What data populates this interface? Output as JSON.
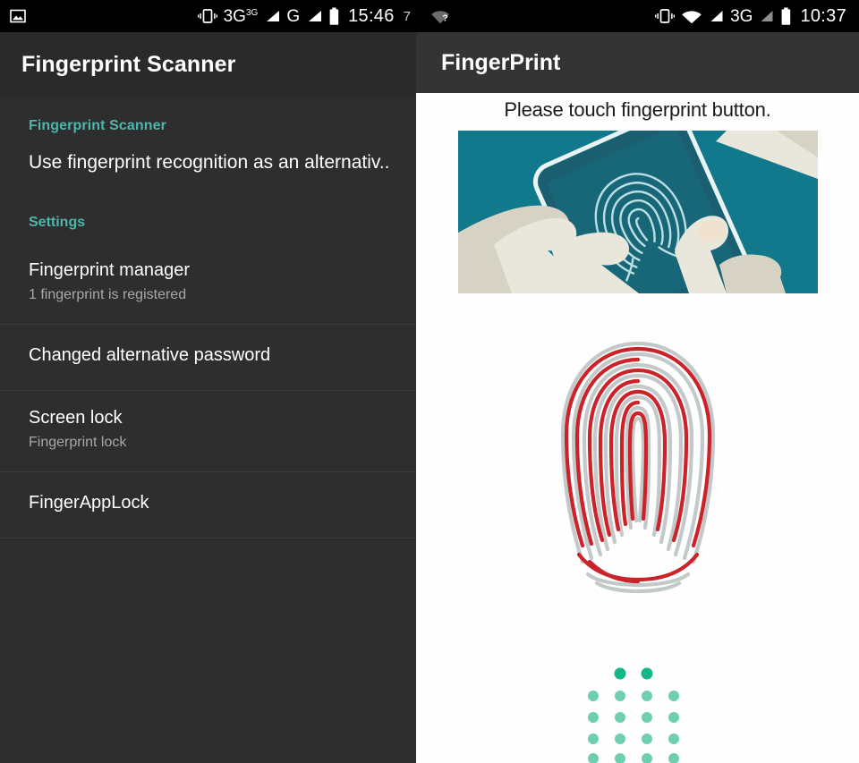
{
  "left_screen": {
    "statusbar": {
      "notification_icon": "image-icon",
      "icons": [
        "vibrate-icon",
        "signal-3g-icon",
        "signal-g-icon",
        "battery-icon"
      ],
      "network_1": "3G",
      "network_1_sup": "3G",
      "network_2": "G",
      "time": "15:46",
      "partial_next_time": "7"
    },
    "appbar": {
      "title": "Fingerprint Scanner"
    },
    "section": {
      "header": "Fingerprint Scanner",
      "description": "Use fingerprint recognition as an alternativ.."
    },
    "settings": {
      "header": "Settings",
      "items": [
        {
          "primary": "Fingerprint manager",
          "secondary": "1 fingerprint is registered"
        },
        {
          "primary": "Changed alternative password",
          "secondary": ""
        },
        {
          "primary": "Screen lock",
          "secondary": "Fingerprint lock"
        },
        {
          "primary": "FingerAppLock",
          "secondary": ""
        }
      ]
    }
  },
  "right_screen": {
    "statusbar": {
      "notification_icon": "wifi-question-icon",
      "icons": [
        "vibrate-icon",
        "wifi-icon",
        "signal-icon",
        "signal-dim-icon",
        "battery-icon"
      ],
      "network": "3G",
      "time": "10:37"
    },
    "appbar": {
      "title": "FingerPrint"
    },
    "instruction": "Please touch fingerprint button.",
    "banner": {
      "alt": "hand-holding-phone-with-fingerprint-illustration"
    },
    "fingerprint_graphic": {
      "alt": "fingerprint-ridges-graphic"
    },
    "dot_grid": {
      "alt": "green-dot-grid-keypad"
    }
  },
  "colors": {
    "accent_teal": "#4db6ac",
    "left_bg": "#2e2e2e",
    "left_appbar": "#2a2a2a",
    "right_appbar": "#343434",
    "statusbar": "#000000",
    "banner_teal": "#12798c",
    "print_red": "#cc2229",
    "print_gray": "#c3c9c9",
    "dot_green": "#6ecfad",
    "dot_green_dark": "#13b886"
  }
}
